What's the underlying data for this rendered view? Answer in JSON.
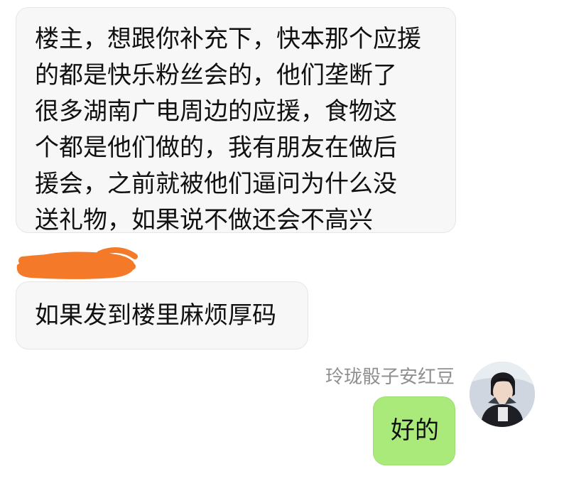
{
  "conversation": {
    "messages": [
      {
        "direction": "incoming",
        "lines": [
          "楼主，想跟你补充下，快本那个应援",
          "的都是快乐粉丝会的，他们垄断了",
          "很多湖南广电周边的应援，食物这",
          "个都是他们做的，我有朋友在做后",
          "援会，之前就被他们逼问为什么没",
          "送礼物，如果说不做还会不高兴"
        ]
      },
      {
        "direction": "incoming",
        "text": "如果发到楼里麻烦厚码"
      },
      {
        "direction": "outgoing",
        "sender": "玲珑骰子安红豆",
        "text": "好的"
      }
    ]
  },
  "colors": {
    "incoming_bubble": "#f7f7f7",
    "outgoing_bubble": "#a9ea7a",
    "redaction_scribble": "#f47a2a",
    "sender_name": "#8f8f8f"
  },
  "icons": {
    "redaction": "orange-scribble-redaction",
    "avatar": "user-avatar-portrait"
  }
}
